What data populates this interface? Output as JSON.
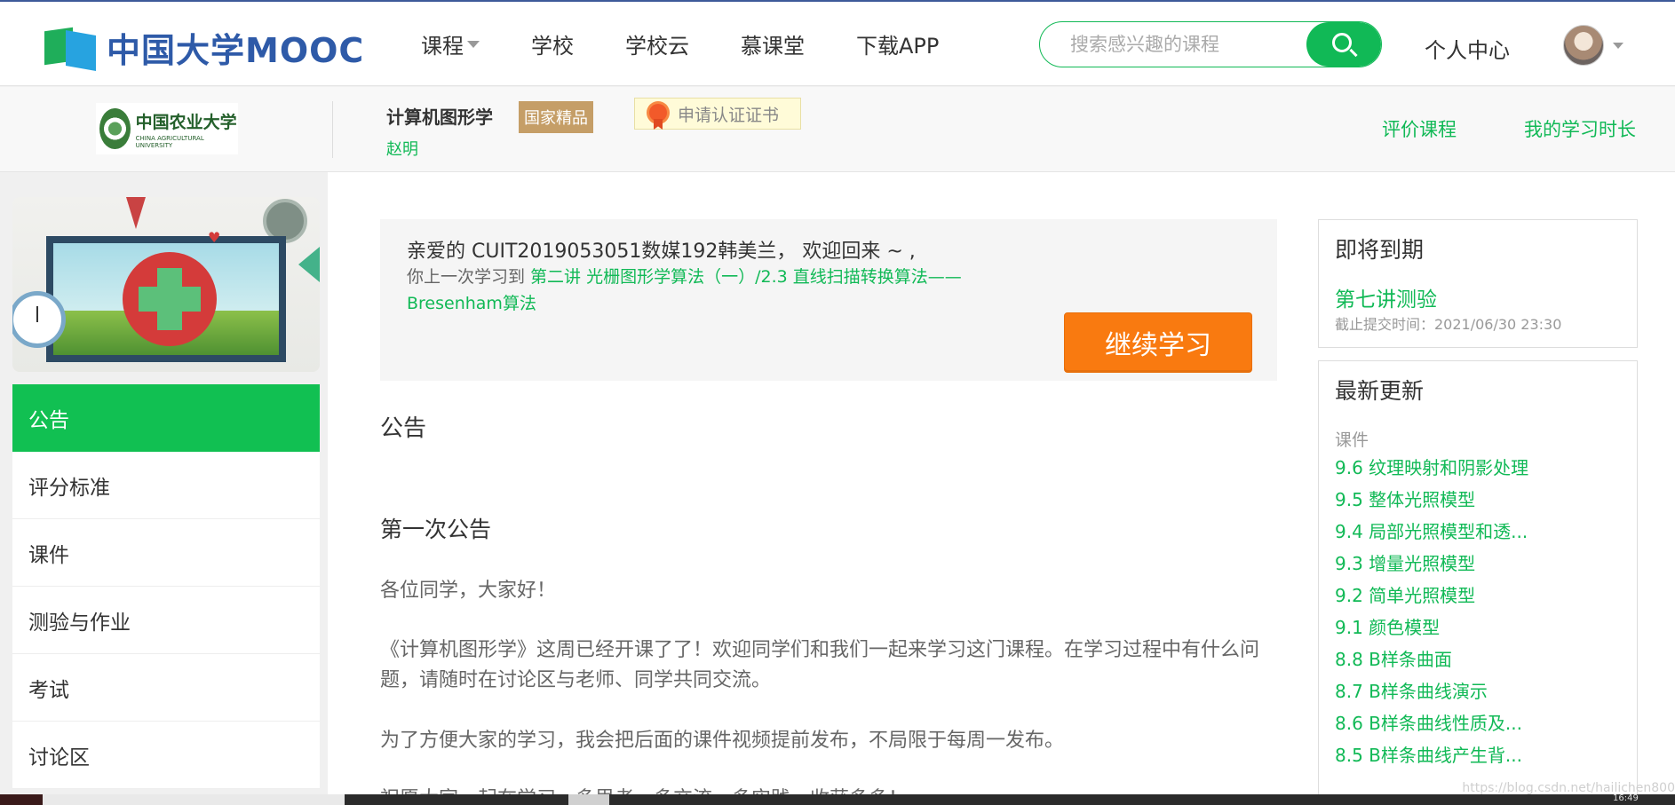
{
  "topbar": {
    "logo_text": "中国大学MOOC",
    "nav": [
      "课程",
      "学校",
      "学校云",
      "慕课堂",
      "下载APP"
    ],
    "search_placeholder": "搜索感兴趣的课程",
    "personal_center": "个人中心"
  },
  "course": {
    "school_cn": "中国农业大学",
    "school_en": "CHINA AGRICULTURAL UNIVERSITY",
    "title": "计算机图形学",
    "badge": "国家精品",
    "cert": "申请认证证书",
    "teacher": "赵明",
    "rate": "评价课程",
    "study_time": "我的学习时长"
  },
  "sidebar": {
    "items": [
      "公告",
      "评分标准",
      "课件",
      "测验与作业",
      "考试",
      "讨论区"
    ]
  },
  "welcome": {
    "line1": "亲爱的 CUIT2019053051数媒192韩美兰， 欢迎回来 ~ ,",
    "line2_prefix": "你上一次学习到 ",
    "line2_link": "第二讲 光栅图形学算法（一）/2.3 直线扫描转换算法——Bresenham算法",
    "continue": "继续学习"
  },
  "announcement": {
    "section": "公告",
    "title": "第一次公告",
    "p1": "各位同学，大家好！",
    "p2": "《计算机图形学》这周已经开课了了！欢迎同学们和我们一起来学习这门课程。在学习过程中有什么问题，请随时在讨论区与老师、同学共同交流。",
    "p3": "为了方便大家的学习，我会把后面的课件视频提前发布，不局限于每周一发布。",
    "p4": "祝愿大家一起在学习、多思考、多交流、多实践，收获多多！"
  },
  "due": {
    "head": "即将到期",
    "item": "第七讲测验",
    "deadline": "截止提交时间：2021/06/30 23:30"
  },
  "updates": {
    "head": "最新更新",
    "category": "课件",
    "items": [
      "9.6 纹理映射和阴影处理",
      "9.5 整体光照模型",
      "9.4 局部光照模型和透...",
      "9.3 增量光照模型",
      "9.2 简单光照模型",
      "9.1 颜色模型",
      "8.8 B样条曲面",
      "8.7 B样条曲线演示",
      "8.6 B样条曲线性质及...",
      "8.5 B样条曲线产生背..."
    ]
  },
  "watermark": "https://blog.csdn.net/hailichen800",
  "clock": "16:49",
  "colors": {
    "accent": "#11b956",
    "orange": "#f97a10",
    "brand_blue": "#2e5aa8"
  }
}
